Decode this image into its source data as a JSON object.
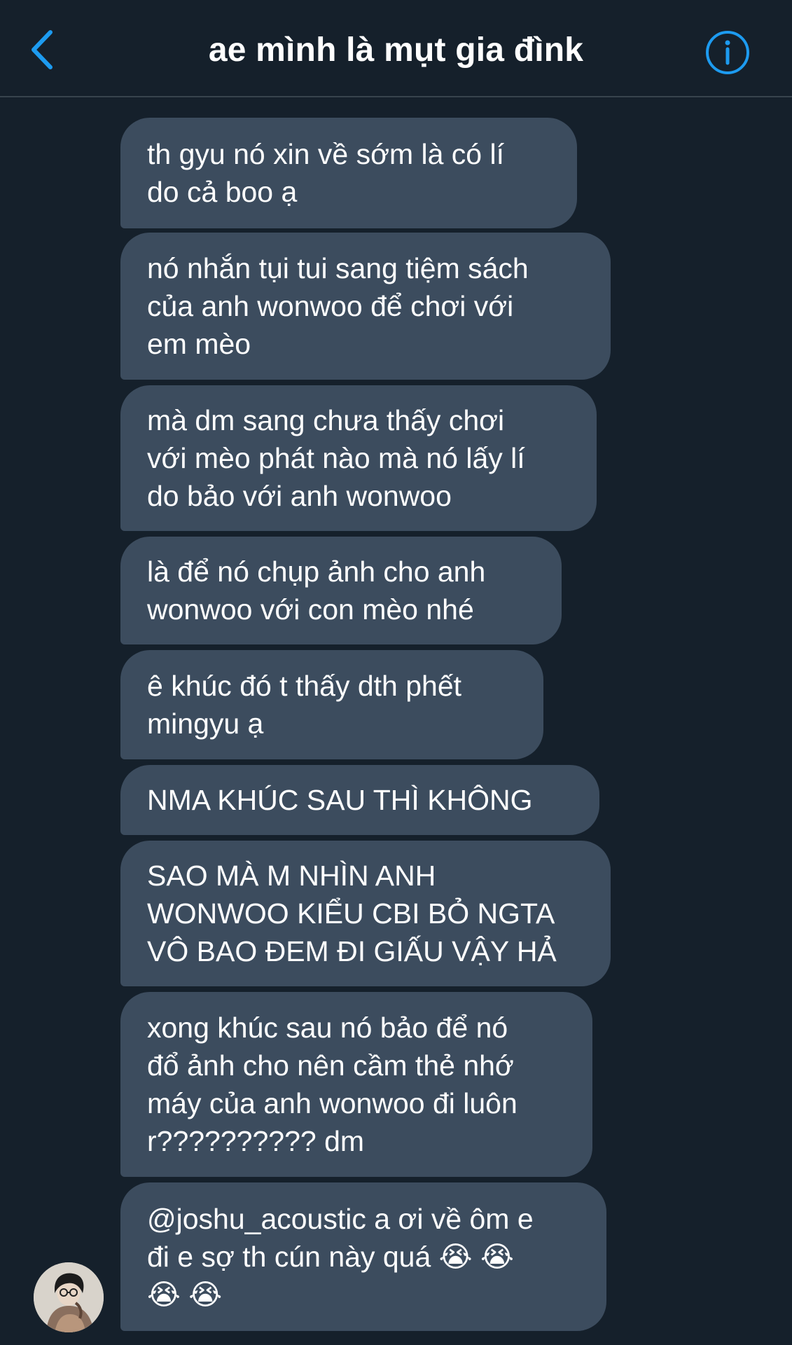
{
  "header": {
    "title": "ae mình là mụt gia đìnk",
    "back_icon": "chevron-left-icon",
    "info_icon": "info-circle-icon",
    "accent_color": "#1d9bf0"
  },
  "messages": [
    {
      "text": "th gyu nó xin về sớm là có lí\ndo cả boo ạ"
    },
    {
      "text": "nó nhắn tụi tui sang tiệm sách\ncủa anh wonwoo để chơi với\nem mèo"
    },
    {
      "text": "mà dm sang chưa thấy chơi\nvới mèo phát nào mà nó lấy lí\ndo bảo với anh wonwoo"
    },
    {
      "text": "là để nó chụp ảnh cho anh\nwonwoo với con mèo nhé"
    },
    {
      "text": "ê khúc đó t thấy dth phết\nmingyu ạ"
    },
    {
      "text": "NMA KHÚC SAU THÌ KHÔNG"
    },
    {
      "text": "SAO MÀ M NHÌN ANH\nWONWOO KIỂU CBI BỎ NGTA\nVÔ BAO ĐEM ĐI GIẤU VẬY HẢ"
    },
    {
      "text": "xong khúc sau nó bảo để nó\nđổ ảnh cho nên cầm thẻ nhớ\nmáy của anh wonwoo đi luôn\nr?????????? dm"
    },
    {
      "text": "@joshu_acoustic a ơi về ôm e\nđi e sợ th cún này quá 😭 😭\n😭 😭"
    }
  ],
  "colors": {
    "background": "#15202b",
    "bubble": "#3c4c5e",
    "divider": "#38444d"
  }
}
